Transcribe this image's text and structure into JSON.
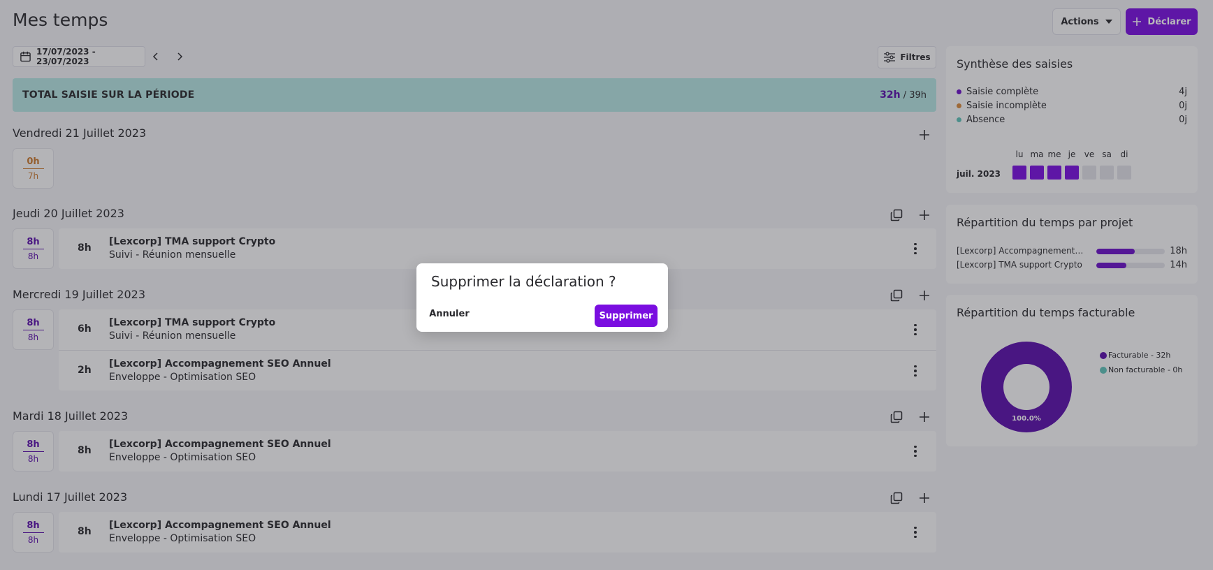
{
  "header": {
    "title": "Mes temps",
    "actions_label": "Actions",
    "declarer_label": "Déclarer"
  },
  "toolbar": {
    "date_range": "17/07/2023 - 23/07/2023",
    "filtres_label": "Filtres"
  },
  "total": {
    "label": "TOTAL SAISIE SUR LA PÉRIODE",
    "value": "32h",
    "separator": " / ",
    "target": "39h"
  },
  "days": [
    {
      "title": "Vendredi 21 Juillet 2023",
      "done": "0h",
      "expected": "7h",
      "entries": []
    },
    {
      "title": "Jeudi 20 Juillet 2023",
      "done": "8h",
      "expected": "8h",
      "entries": [
        {
          "hours": "8h",
          "project": "[Lexcorp] TMA support Crypto",
          "task": "Suivi - Réunion mensuelle"
        }
      ]
    },
    {
      "title": "Mercredi 19 Juillet 2023",
      "done": "8h",
      "expected": "8h",
      "entries": [
        {
          "hours": "6h",
          "project": "[Lexcorp] TMA support Crypto",
          "task": "Suivi - Réunion mensuelle"
        },
        {
          "hours": "2h",
          "project": "[Lexcorp] Accompagnement SEO Annuel",
          "task": "Enveloppe - Optimisation SEO"
        }
      ]
    },
    {
      "title": "Mardi 18 Juillet 2023",
      "done": "8h",
      "expected": "8h",
      "entries": [
        {
          "hours": "8h",
          "project": "[Lexcorp] Accompagnement SEO Annuel",
          "task": "Enveloppe - Optimisation SEO"
        }
      ]
    },
    {
      "title": "Lundi 17 Juillet 2023",
      "done": "8h",
      "expected": "8h",
      "entries": [
        {
          "hours": "8h",
          "project": "[Lexcorp] Accompagnement SEO Annuel",
          "task": "Enveloppe - Optimisation SEO"
        }
      ]
    }
  ],
  "synthese": {
    "title": "Synthèse des saisies",
    "legend": [
      {
        "label": "Saisie complète",
        "value": "4j",
        "color": "#6a10c8"
      },
      {
        "label": "Saisie incomplète",
        "value": "0j",
        "color": "#d98a3c"
      },
      {
        "label": "Absence",
        "value": "0j",
        "color": "#5fc2b8"
      }
    ],
    "month": "juil. 2023",
    "weekdays": [
      "lu",
      "ma",
      "me",
      "je",
      "ve",
      "sa",
      "di"
    ],
    "week_status": [
      "complete",
      "complete",
      "complete",
      "complete",
      "empty",
      "empty",
      "empty"
    ]
  },
  "repartition_projet": {
    "title": "Répartition du temps par projet",
    "projects": [
      {
        "name": "[Lexcorp] Accompagnement S...",
        "value": "18h",
        "fraction": 0.5625
      },
      {
        "name": "[Lexcorp] TMA support Crypto",
        "value": "14h",
        "fraction": 0.4375
      }
    ]
  },
  "repartition_facturable": {
    "title": "Répartition du temps facturable",
    "center_label": "100.0%",
    "legend": [
      {
        "label": "Facturable - 32h",
        "color": "#5a0eaa"
      },
      {
        "label": "Non facturable - 0h",
        "color": "#5fc2b8"
      }
    ]
  },
  "chart_data": {
    "type": "pie",
    "title": "Répartition du temps facturable",
    "categories": [
      "Facturable",
      "Non facturable"
    ],
    "values": [
      32,
      0
    ],
    "data_labels": [
      "100.0%"
    ]
  },
  "colors": {
    "accent": "#7a0ee0",
    "accent_dark": "#5a0eaa",
    "total_bg": "#b5e5e1",
    "warning": "#c9792e",
    "empty_day": "#e0e0e6"
  },
  "modal": {
    "title": "Supprimer la déclaration ?",
    "cancel_label": "Annuler",
    "confirm_label": "Supprimer"
  }
}
